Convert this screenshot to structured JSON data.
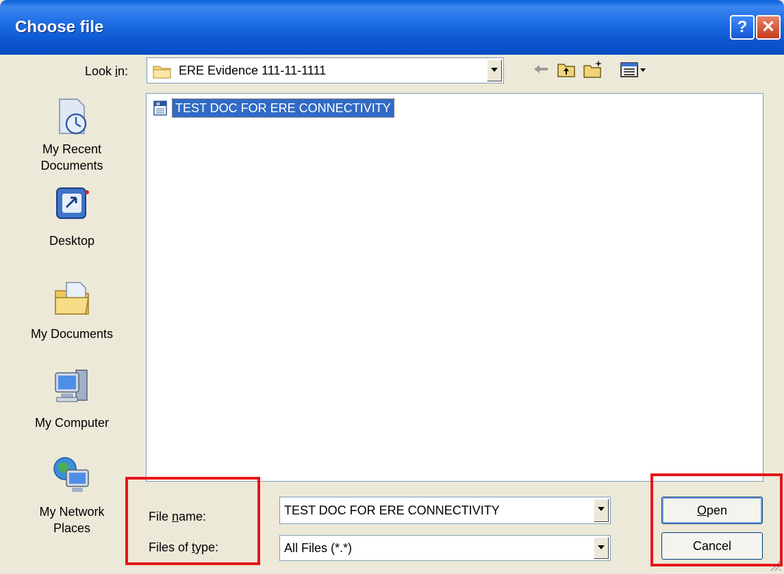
{
  "window": {
    "title": "Choose file",
    "help_glyph": "?",
    "close_glyph": "✕"
  },
  "toolbar": {
    "look_in_label_pre": "Look ",
    "look_in_label_key": "i",
    "look_in_label_post": "n:",
    "look_in_value": "ERE  Evidence 111-11-1111",
    "icons": [
      "back-arrow-icon",
      "up-folder-icon",
      "new-folder-icon",
      "views-menu-icon"
    ]
  },
  "places": [
    {
      "label_line1": "My Recent",
      "label_line2": "Documents",
      "icon": "recent-documents-icon"
    },
    {
      "label_line1": "Desktop",
      "label_line2": "",
      "icon": "desktop-icon"
    },
    {
      "label_line1": "My Documents",
      "label_line2": "",
      "icon": "my-documents-icon"
    },
    {
      "label_line1": "My Computer",
      "label_line2": "",
      "icon": "my-computer-icon"
    },
    {
      "label_line1": "My Network",
      "label_line2": "Places",
      "icon": "network-places-icon"
    }
  ],
  "files": [
    {
      "name": "TEST DOC FOR ERE CONNECTIVITY",
      "icon": "word-document-icon",
      "selected": true
    }
  ],
  "form": {
    "file_name_label_pre": "File ",
    "file_name_label_key": "n",
    "file_name_label_post": "ame:",
    "file_name_value": "TEST DOC FOR ERE CONNECTIVITY",
    "file_type_label_pre": "Files of ",
    "file_type_label_key": "t",
    "file_type_label_post": "ype:",
    "file_type_value": "All Files (*.*)"
  },
  "buttons": {
    "open_key": "O",
    "open_rest": "pen",
    "cancel": "Cancel"
  },
  "colors": {
    "titlebar": "#0a5fd8",
    "dialog_bg": "#ece9d8",
    "selection": "#316ac5",
    "highlight_box": "#e8141b"
  }
}
